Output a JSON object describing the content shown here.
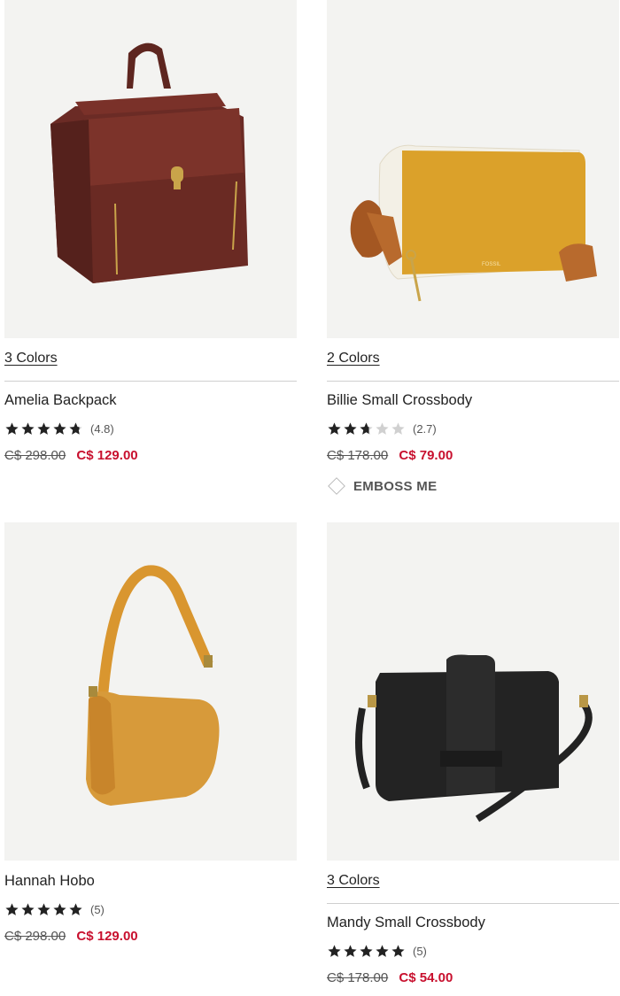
{
  "products": [
    {
      "id": "c1",
      "colors_label": "3 Colors",
      "name": "Amelia Backpack",
      "rating_stars": 4.8,
      "rating_count": "(4.8)",
      "original_price": "C$ 298.00",
      "sale_price": "C$ 129.00",
      "image_icon": "backpack-image"
    },
    {
      "id": "c2",
      "colors_label": "2 Colors",
      "name": "Billie Small Crossbody",
      "rating_stars": 2.7,
      "rating_count": "(2.7)",
      "original_price": "C$ 178.00",
      "sale_price": "C$ 79.00",
      "emboss_label": "EMBOSS ME",
      "image_icon": "crossbody-image"
    },
    {
      "id": "c3",
      "name": "Hannah Hobo",
      "rating_stars": 5,
      "rating_count": "(5)",
      "original_price": "C$ 298.00",
      "sale_price": "C$ 129.00",
      "image_icon": "hobo-image"
    },
    {
      "id": "c4",
      "colors_label": "3 Colors",
      "name": "Mandy Small Crossbody",
      "rating_stars": 5,
      "rating_count": "(5)",
      "original_price": "C$ 178.00",
      "sale_price": "C$ 54.00",
      "image_icon": "crossbody-image"
    }
  ],
  "colors": {
    "sale": "#c8102e",
    "star_filled": "#222222",
    "star_empty": "#d0d0d0",
    "image_bg": "#f3f3f1"
  }
}
